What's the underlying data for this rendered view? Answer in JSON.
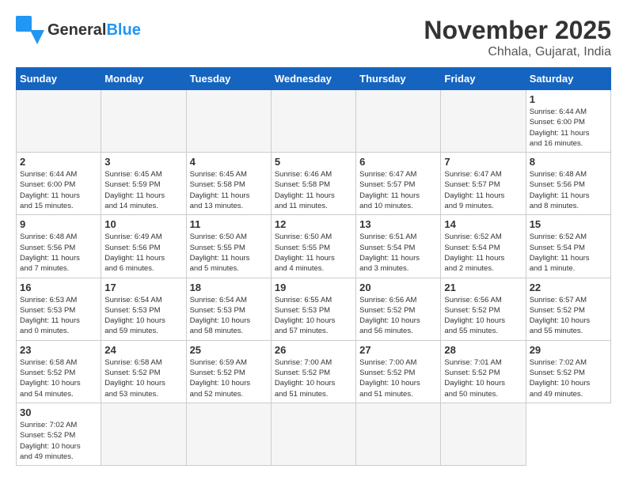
{
  "header": {
    "logo_general": "General",
    "logo_blue": "Blue",
    "month_title": "November 2025",
    "location": "Chhala, Gujarat, India"
  },
  "weekdays": [
    "Sunday",
    "Monday",
    "Tuesday",
    "Wednesday",
    "Thursday",
    "Friday",
    "Saturday"
  ],
  "days": [
    {
      "day": "",
      "empty": true
    },
    {
      "day": "",
      "empty": true
    },
    {
      "day": "",
      "empty": true
    },
    {
      "day": "",
      "empty": true
    },
    {
      "day": "",
      "empty": true
    },
    {
      "day": "",
      "empty": true
    },
    {
      "day": "1",
      "info": "Sunrise: 6:44 AM\nSunset: 6:00 PM\nDaylight: 11 hours\nand 16 minutes."
    },
    {
      "day": "2",
      "info": "Sunrise: 6:44 AM\nSunset: 6:00 PM\nDaylight: 11 hours\nand 15 minutes."
    },
    {
      "day": "3",
      "info": "Sunrise: 6:45 AM\nSunset: 5:59 PM\nDaylight: 11 hours\nand 14 minutes."
    },
    {
      "day": "4",
      "info": "Sunrise: 6:45 AM\nSunset: 5:58 PM\nDaylight: 11 hours\nand 13 minutes."
    },
    {
      "day": "5",
      "info": "Sunrise: 6:46 AM\nSunset: 5:58 PM\nDaylight: 11 hours\nand 11 minutes."
    },
    {
      "day": "6",
      "info": "Sunrise: 6:47 AM\nSunset: 5:57 PM\nDaylight: 11 hours\nand 10 minutes."
    },
    {
      "day": "7",
      "info": "Sunrise: 6:47 AM\nSunset: 5:57 PM\nDaylight: 11 hours\nand 9 minutes."
    },
    {
      "day": "8",
      "info": "Sunrise: 6:48 AM\nSunset: 5:56 PM\nDaylight: 11 hours\nand 8 minutes."
    },
    {
      "day": "9",
      "info": "Sunrise: 6:48 AM\nSunset: 5:56 PM\nDaylight: 11 hours\nand 7 minutes."
    },
    {
      "day": "10",
      "info": "Sunrise: 6:49 AM\nSunset: 5:56 PM\nDaylight: 11 hours\nand 6 minutes."
    },
    {
      "day": "11",
      "info": "Sunrise: 6:50 AM\nSunset: 5:55 PM\nDaylight: 11 hours\nand 5 minutes."
    },
    {
      "day": "12",
      "info": "Sunrise: 6:50 AM\nSunset: 5:55 PM\nDaylight: 11 hours\nand 4 minutes."
    },
    {
      "day": "13",
      "info": "Sunrise: 6:51 AM\nSunset: 5:54 PM\nDaylight: 11 hours\nand 3 minutes."
    },
    {
      "day": "14",
      "info": "Sunrise: 6:52 AM\nSunset: 5:54 PM\nDaylight: 11 hours\nand 2 minutes."
    },
    {
      "day": "15",
      "info": "Sunrise: 6:52 AM\nSunset: 5:54 PM\nDaylight: 11 hours\nand 1 minute."
    },
    {
      "day": "16",
      "info": "Sunrise: 6:53 AM\nSunset: 5:53 PM\nDaylight: 11 hours\nand 0 minutes."
    },
    {
      "day": "17",
      "info": "Sunrise: 6:54 AM\nSunset: 5:53 PM\nDaylight: 10 hours\nand 59 minutes."
    },
    {
      "day": "18",
      "info": "Sunrise: 6:54 AM\nSunset: 5:53 PM\nDaylight: 10 hours\nand 58 minutes."
    },
    {
      "day": "19",
      "info": "Sunrise: 6:55 AM\nSunset: 5:53 PM\nDaylight: 10 hours\nand 57 minutes."
    },
    {
      "day": "20",
      "info": "Sunrise: 6:56 AM\nSunset: 5:52 PM\nDaylight: 10 hours\nand 56 minutes."
    },
    {
      "day": "21",
      "info": "Sunrise: 6:56 AM\nSunset: 5:52 PM\nDaylight: 10 hours\nand 55 minutes."
    },
    {
      "day": "22",
      "info": "Sunrise: 6:57 AM\nSunset: 5:52 PM\nDaylight: 10 hours\nand 55 minutes."
    },
    {
      "day": "23",
      "info": "Sunrise: 6:58 AM\nSunset: 5:52 PM\nDaylight: 10 hours\nand 54 minutes."
    },
    {
      "day": "24",
      "info": "Sunrise: 6:58 AM\nSunset: 5:52 PM\nDaylight: 10 hours\nand 53 minutes."
    },
    {
      "day": "25",
      "info": "Sunrise: 6:59 AM\nSunset: 5:52 PM\nDaylight: 10 hours\nand 52 minutes."
    },
    {
      "day": "26",
      "info": "Sunrise: 7:00 AM\nSunset: 5:52 PM\nDaylight: 10 hours\nand 51 minutes."
    },
    {
      "day": "27",
      "info": "Sunrise: 7:00 AM\nSunset: 5:52 PM\nDaylight: 10 hours\nand 51 minutes."
    },
    {
      "day": "28",
      "info": "Sunrise: 7:01 AM\nSunset: 5:52 PM\nDaylight: 10 hours\nand 50 minutes."
    },
    {
      "day": "29",
      "info": "Sunrise: 7:02 AM\nSunset: 5:52 PM\nDaylight: 10 hours\nand 49 minutes."
    },
    {
      "day": "30",
      "info": "Sunrise: 7:02 AM\nSunset: 5:52 PM\nDaylight: 10 hours\nand 49 minutes."
    },
    {
      "day": "",
      "empty": true
    },
    {
      "day": "",
      "empty": true
    },
    {
      "day": "",
      "empty": true
    },
    {
      "day": "",
      "empty": true
    },
    {
      "day": "",
      "empty": true
    }
  ]
}
